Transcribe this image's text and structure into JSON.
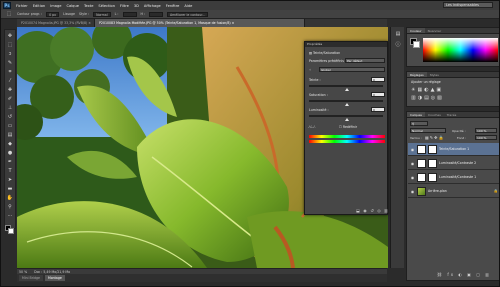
{
  "app": {
    "logo": "Ps"
  },
  "menu": [
    "Fichier",
    "Edition",
    "Image",
    "Calque",
    "Texte",
    "Sélection",
    "Filtre",
    "3D",
    "Affichage",
    "Fenêtre",
    "Aide"
  ],
  "workspace": "Les indispensables",
  "options": {
    "contour_label": "Contour progr. :",
    "contour_value": "0 px",
    "lisser": "Lissage",
    "style_label": "Style :",
    "style_value": "Normal",
    "l_label": "L :",
    "h_label": "H :",
    "ameliorer": "Améliorer le contour..."
  },
  "tabs": [
    {
      "label": "P2010074 Magnolia.JPG @ 33,3% (RVB/8) ×"
    },
    {
      "label": "P2010083 Magnolia Modifiée.JPG @ 50% (Teinte/Saturation 1, Masque de fusion/8) ×"
    }
  ],
  "status": {
    "zoom": "50 %",
    "doc": "Doc : 5,49 Mo/21,9 Mo"
  },
  "bottom_tabs": [
    "Mini Bridge",
    "Montage"
  ],
  "properties": {
    "title": "Propriétés",
    "adjustment_name": "Teinte/Saturation",
    "preset_label": "Paramètres prédéfinis :",
    "preset_value": "Par défaut",
    "channel_value": "Global",
    "hue_label": "Teinte :",
    "hue_value": "0",
    "saturation_label": "Saturation :",
    "saturation_value": "0",
    "lightness_label": "Luminosité :",
    "lightness_value": "0",
    "colorize_label": "Redéfinir",
    "hue_position": 0.5,
    "saturation_position": 0.5,
    "lightness_position": 0.5
  },
  "color_panel": {
    "tabs": [
      "Couleur",
      "Nuancier"
    ]
  },
  "adjust_panel": {
    "tabs": [
      "Réglages",
      "Styles"
    ],
    "title": "Ajouter un réglage"
  },
  "layers_panel": {
    "tabs": [
      "Calques",
      "Couches",
      "Tracés"
    ],
    "blend_mode": "Normal",
    "opacity_label": "Opacité :",
    "opacity_value": "100 %",
    "lock_label": "Verrou :",
    "fill_label": "Fond :",
    "fill_value": "100 %",
    "layers": [
      {
        "name": "Teinte/Saturation 1",
        "selected": true
      },
      {
        "name": "Luminosité/Contraste 2",
        "selected": false
      },
      {
        "name": "Luminosité/Contraste 1",
        "selected": false
      },
      {
        "name": "Arrière-plan",
        "selected": false
      }
    ]
  },
  "colors": {
    "accent": "#5b7293",
    "bg": "#2b2b2b"
  }
}
